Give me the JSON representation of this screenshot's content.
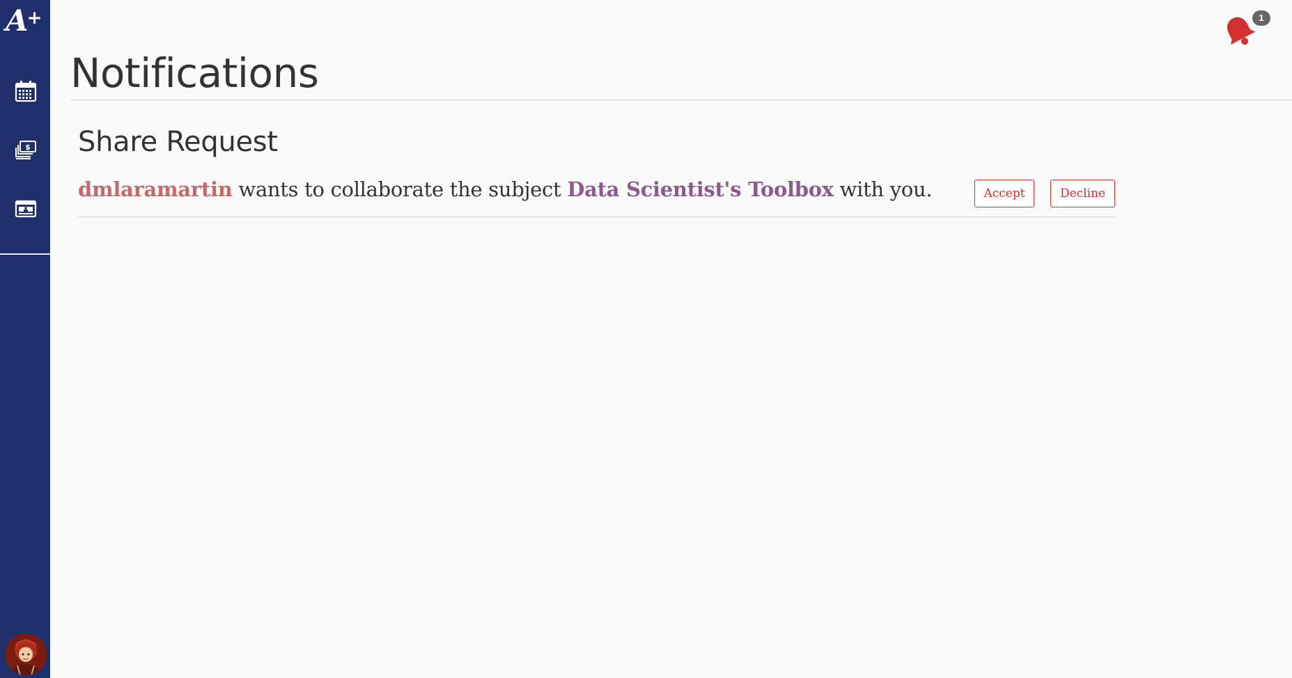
{
  "app": {
    "logo_text": "A",
    "logo_plus": "+"
  },
  "sidebar": {
    "items": [
      {
        "name": "calendar",
        "icon": "calendar-icon"
      },
      {
        "name": "payments",
        "icon": "money-stack-icon"
      },
      {
        "name": "id-card",
        "icon": "id-card-icon"
      }
    ],
    "avatar_icon": "user-avatar"
  },
  "header": {
    "notification_count": "1",
    "bell_color": "#d32f2f"
  },
  "page": {
    "title": "Notifications"
  },
  "notifications": {
    "section_title": "Share Request",
    "request": {
      "username": "dmlaramartin",
      "text_before": " wants to collaborate the subject ",
      "subject": "Data Scientist's Toolbox",
      "text_after": " with you.",
      "accept_label": "Accept",
      "decline_label": "Decline"
    }
  },
  "colors": {
    "sidebar": "#1f2f6b",
    "username": "#c46a6a",
    "subject": "#8e5a8e",
    "button_accent": "#d32f2f"
  }
}
